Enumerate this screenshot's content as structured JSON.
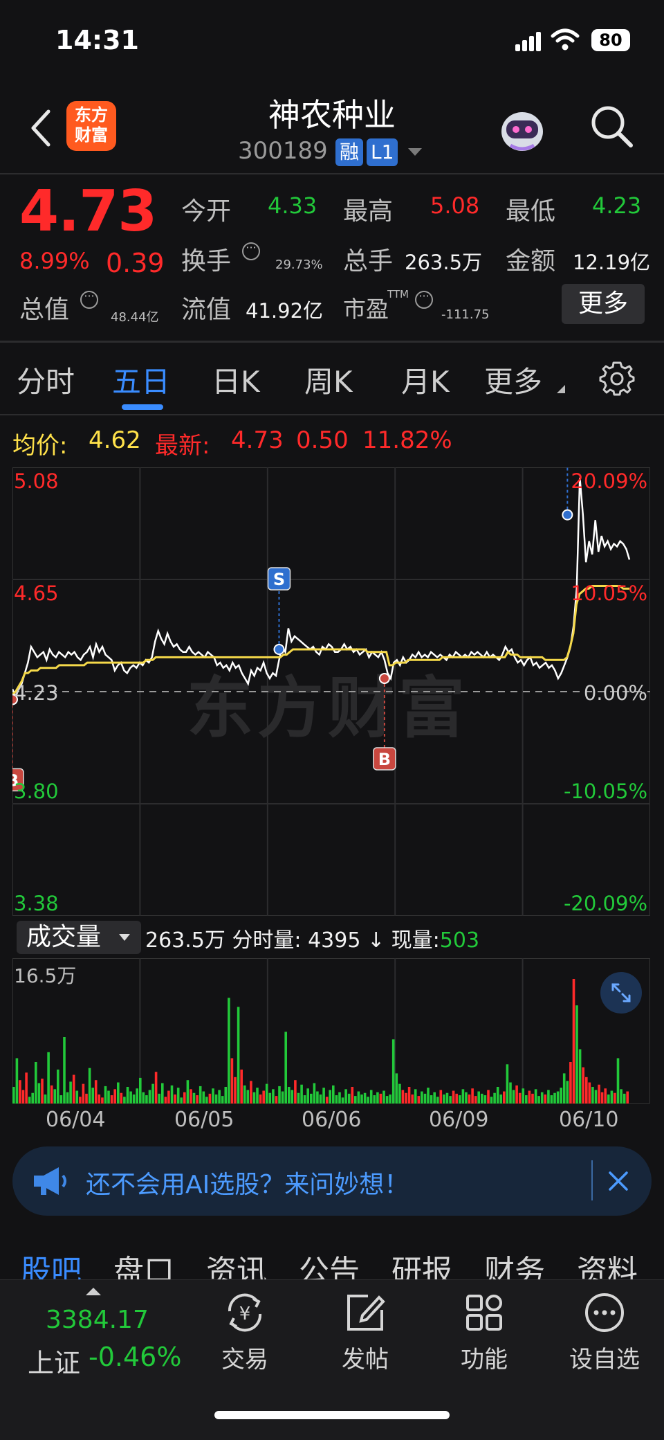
{
  "status_bar": {
    "time": "14:31",
    "battery": "80"
  },
  "header": {
    "logo_line1": "东方",
    "logo_line2": "财富",
    "stock_name": "神农种业",
    "stock_code": "300189",
    "tag_rong": "融",
    "tag_level": "L1"
  },
  "quote": {
    "price": "4.73",
    "change_pct": "8.99%",
    "change_abs": "0.39",
    "open_label": "今开",
    "open": "4.33",
    "high_label": "最高",
    "high": "5.08",
    "low_label": "最低",
    "low": "4.23",
    "turnover_label": "换手",
    "turnover": "29.73%",
    "volume_label": "总手",
    "volume": "263.5万",
    "amount_label": "金额",
    "amount": "12.19亿",
    "mktcap_label": "总值",
    "mktcap": "48.44亿",
    "float_label": "流值",
    "float_cap": "41.92亿",
    "pe_label": "市盈",
    "pe_sup": "TTM",
    "pe": "-111.75",
    "more_label": "更多"
  },
  "tabs": [
    "分时",
    "五日",
    "日K",
    "周K",
    "月K",
    "更多"
  ],
  "active_tab": "五日",
  "legend": {
    "avg_label": "均价:",
    "avg": "4.62",
    "latest_label": "最新:",
    "latest": "4.73",
    "latest_chg": "0.50",
    "latest_pct": "11.82%"
  },
  "watermark": "东方财富",
  "chart_data": {
    "type": "line",
    "y_left_ticks": [
      "5.08",
      "4.65",
      "4.23",
      "3.80",
      "3.38"
    ],
    "y_right_ticks": [
      "20.09%",
      "10.05%",
      "0.00%",
      "-10.05%",
      "-20.09%"
    ],
    "ylim": [
      3.38,
      5.08
    ],
    "prev_close": 4.23,
    "x_dates": [
      "06/04",
      "06/05",
      "06/06",
      "06/09",
      "06/10"
    ],
    "series": [
      {
        "values": [
          4.24,
          4.21,
          4.24,
          4.26,
          4.3,
          4.34,
          4.4,
          4.38,
          4.36,
          4.37,
          4.38,
          4.35,
          4.39,
          4.37,
          4.36,
          4.38,
          4.37,
          4.36,
          4.38,
          4.37,
          4.38,
          4.36,
          4.35,
          4.37,
          4.38,
          4.4,
          4.36,
          4.41,
          4.38,
          4.4,
          4.37,
          4.36,
          4.35,
          4.31,
          4.33,
          4.34,
          4.31,
          4.3,
          4.32,
          4.33,
          4.32,
          4.34,
          4.33,
          4.35,
          4.34,
          4.36,
          4.42,
          4.46,
          4.43,
          4.41,
          4.45,
          4.42,
          4.4,
          4.41,
          4.39,
          4.38,
          4.38,
          4.4,
          4.38,
          4.37,
          4.38,
          4.37,
          4.36,
          4.38,
          4.37,
          4.36,
          4.33,
          4.34,
          4.32,
          4.33,
          4.31,
          4.34,
          4.32,
          4.33,
          4.3,
          4.28,
          4.26,
          4.31,
          4.29,
          4.32,
          4.31,
          4.34,
          4.3,
          4.28,
          4.3,
          4.29,
          4.35,
          4.4,
          4.38,
          4.47,
          4.42,
          4.44,
          4.43,
          4.42,
          4.41,
          4.4,
          4.39,
          4.4,
          4.38,
          4.37,
          4.4,
          4.39,
          4.41,
          4.4,
          4.38,
          4.38,
          4.39,
          4.41,
          4.39,
          4.4,
          4.38,
          4.39,
          4.37,
          4.38,
          4.39,
          4.36,
          4.38,
          4.37,
          4.36,
          4.38,
          4.35,
          4.3,
          4.28,
          4.34,
          4.35,
          4.33,
          4.36,
          4.34,
          4.35,
          4.37,
          4.36,
          4.38,
          4.36,
          4.37,
          4.36,
          4.38,
          4.37,
          4.36,
          4.37,
          4.36,
          4.35,
          4.37,
          4.36,
          4.38,
          4.37,
          4.36,
          4.37,
          4.36,
          4.38,
          4.37,
          4.38,
          4.37,
          4.36,
          4.38,
          4.36,
          4.37,
          4.36,
          4.35,
          4.37,
          4.4,
          4.38,
          4.39,
          4.36,
          4.34,
          4.35,
          4.33,
          4.35,
          4.36,
          4.33,
          4.34,
          4.32,
          4.33,
          4.34,
          4.32,
          4.33,
          4.31,
          4.28,
          4.3,
          4.33,
          4.36,
          4.4,
          4.48,
          4.62,
          5.04,
          4.9,
          4.72,
          4.8,
          4.75,
          4.88,
          4.76,
          4.82,
          4.78,
          4.8,
          4.77,
          4.79,
          4.78,
          4.8,
          4.79,
          4.77,
          4.73
        ],
        "color": "#ffffff"
      },
      {
        "name": "均价",
        "values": [
          4.22,
          4.23,
          4.25,
          4.27,
          4.3,
          4.3,
          4.31,
          4.31,
          4.31,
          4.32,
          4.32,
          4.32,
          4.32,
          4.32,
          4.32,
          4.33,
          4.33,
          4.33,
          4.33,
          4.33,
          4.33,
          4.33,
          4.33,
          4.33,
          4.34,
          4.34,
          4.34,
          4.34,
          4.34,
          4.34,
          4.34,
          4.34,
          4.34,
          4.34,
          4.34,
          4.34,
          4.34,
          4.34,
          4.34,
          4.34,
          4.34,
          4.34,
          4.34,
          4.35,
          4.35,
          4.35,
          4.36,
          4.36,
          4.36,
          4.36,
          4.36,
          4.36,
          4.36,
          4.36,
          4.36,
          4.36,
          4.36,
          4.36,
          4.36,
          4.36,
          4.36,
          4.36,
          4.36,
          4.36,
          4.36,
          4.36,
          4.36,
          4.36,
          4.36,
          4.36,
          4.36,
          4.36,
          4.36,
          4.36,
          4.36,
          4.36,
          4.36,
          4.36,
          4.36,
          4.36,
          4.36,
          4.36,
          4.36,
          4.36,
          4.36,
          4.36,
          4.36,
          4.37,
          4.37,
          4.38,
          4.39,
          4.39,
          4.39,
          4.39,
          4.39,
          4.39,
          4.39,
          4.39,
          4.39,
          4.39,
          4.39,
          4.39,
          4.39,
          4.39,
          4.39,
          4.39,
          4.39,
          4.39,
          4.39,
          4.39,
          4.39,
          4.39,
          4.39,
          4.39,
          4.38,
          4.38,
          4.38,
          4.38,
          4.38,
          4.38,
          4.38,
          4.33,
          4.33,
          4.34,
          4.34,
          4.34,
          4.34,
          4.35,
          4.35,
          4.35,
          4.35,
          4.35,
          4.35,
          4.35,
          4.35,
          4.35,
          4.35,
          4.35,
          4.36,
          4.36,
          4.36,
          4.36,
          4.36,
          4.36,
          4.36,
          4.36,
          4.36,
          4.36,
          4.36,
          4.36,
          4.36,
          4.36,
          4.36,
          4.36,
          4.36,
          4.36,
          4.36,
          4.36,
          4.36,
          4.38,
          4.37,
          4.37,
          4.37,
          4.36,
          4.36,
          4.36,
          4.36,
          4.36,
          4.36,
          4.36,
          4.36,
          4.35,
          4.35,
          4.35,
          4.35,
          4.35,
          4.35,
          4.35,
          4.36,
          4.4,
          4.45,
          4.56,
          4.6,
          4.61,
          4.62,
          4.62,
          4.63,
          4.63,
          4.63,
          4.63,
          4.63,
          4.63,
          4.63,
          4.63,
          4.63,
          4.63,
          4.62,
          4.62,
          4.62
        ],
        "color": "#f5d94a"
      }
    ],
    "markers": [
      {
        "label": "B",
        "price": 4.2,
        "idx": 0,
        "color": "#c9473f"
      },
      {
        "label": "S",
        "price": 4.39,
        "idx": 86,
        "color": "#2f6fcf"
      },
      {
        "label": "B",
        "price": 4.28,
        "idx": 120,
        "color": "#c9473f"
      },
      {
        "label": "S",
        "price": 4.9,
        "idx": 179,
        "color": "#2f6fcf"
      }
    ]
  },
  "volume_panel": {
    "selector_label": "成交量",
    "total": "263.5万",
    "seg_label": "分时量:",
    "seg_value": "4395",
    "arrow": "↓",
    "now_label": "现量:",
    "now_value": "503",
    "max_label": "16.5万",
    "max_value": 165000,
    "bars": [
      22000,
      60000,
      31000,
      18000,
      41000,
      9000,
      14000,
      55000,
      27000,
      33000,
      12000,
      68000,
      24000,
      19000,
      45000,
      11000,
      88000,
      15000,
      29000,
      38000,
      17000,
      9000,
      26000,
      13000,
      47000,
      21000,
      31000,
      12000,
      8000,
      23000,
      17000,
      11000,
      19000,
      28000,
      14000,
      9000,
      22000,
      16000,
      12000,
      20000,
      34000,
      15000,
      11000,
      18000,
      26000,
      42000,
      13000,
      27000,
      9000,
      17000,
      24000,
      12000,
      21000,
      8000,
      15000,
      31000,
      19000,
      14000,
      11000,
      23000,
      16000,
      9000,
      13000,
      20000,
      12000,
      18000,
      10000,
      22000,
      140000,
      60000,
      35000,
      128000,
      45000,
      24000,
      18000,
      30000,
      15000,
      21000,
      12000,
      17000,
      26000,
      14000,
      19000,
      10000,
      23000,
      16000,
      95000,
      22000,
      18000,
      31000,
      14000,
      25000,
      11000,
      20000,
      13000,
      27000,
      16000,
      12000,
      21000,
      9000,
      18000,
      24000,
      11000,
      15000,
      8000,
      19000,
      13000,
      22000,
      10000,
      16000,
      12000,
      14000,
      9000,
      18000,
      11000,
      15000,
      13000,
      17000,
      10000,
      12000,
      85000,
      40000,
      26000,
      18000,
      14000,
      22000,
      12000,
      19000,
      10000,
      16000,
      13000,
      21000,
      11000,
      15000,
      9000,
      18000,
      12000,
      14000,
      10000,
      17000,
      13000,
      11000,
      19000,
      15000,
      12000,
      20000,
      10000,
      16000,
      13000,
      11000,
      18000,
      9000,
      14000,
      22000,
      12000,
      16000,
      52000,
      28000,
      18000,
      24000,
      14000,
      20000,
      11000,
      17000,
      13000,
      19000,
      10000,
      15000,
      12000,
      18000,
      11000,
      14000,
      16000,
      21000,
      40000,
      30000,
      55000,
      165000,
      130000,
      72000,
      48000,
      35000,
      28000,
      22000,
      18000,
      25000,
      15000,
      20000,
      12000,
      17000,
      14000,
      60000,
      19000,
      13000,
      16000
    ],
    "colors": "mixed-red-green"
  },
  "banner": {
    "text": "还不会用AI选股？来问妙想！"
  },
  "bottom_tabs": [
    "股吧",
    "盘口",
    "资讯",
    "公告",
    "研报",
    "财务",
    "资料"
  ],
  "active_bottom_tab": "股吧",
  "index": {
    "value": "3384.17",
    "name": "上证",
    "pct": "-0.46%"
  },
  "toolbar": [
    {
      "label": "交易",
      "icon": "trade-icon"
    },
    {
      "label": "发帖",
      "icon": "post-icon"
    },
    {
      "label": "功能",
      "icon": "grid-icon"
    },
    {
      "label": "设自选",
      "icon": "more-dots-icon"
    }
  ]
}
